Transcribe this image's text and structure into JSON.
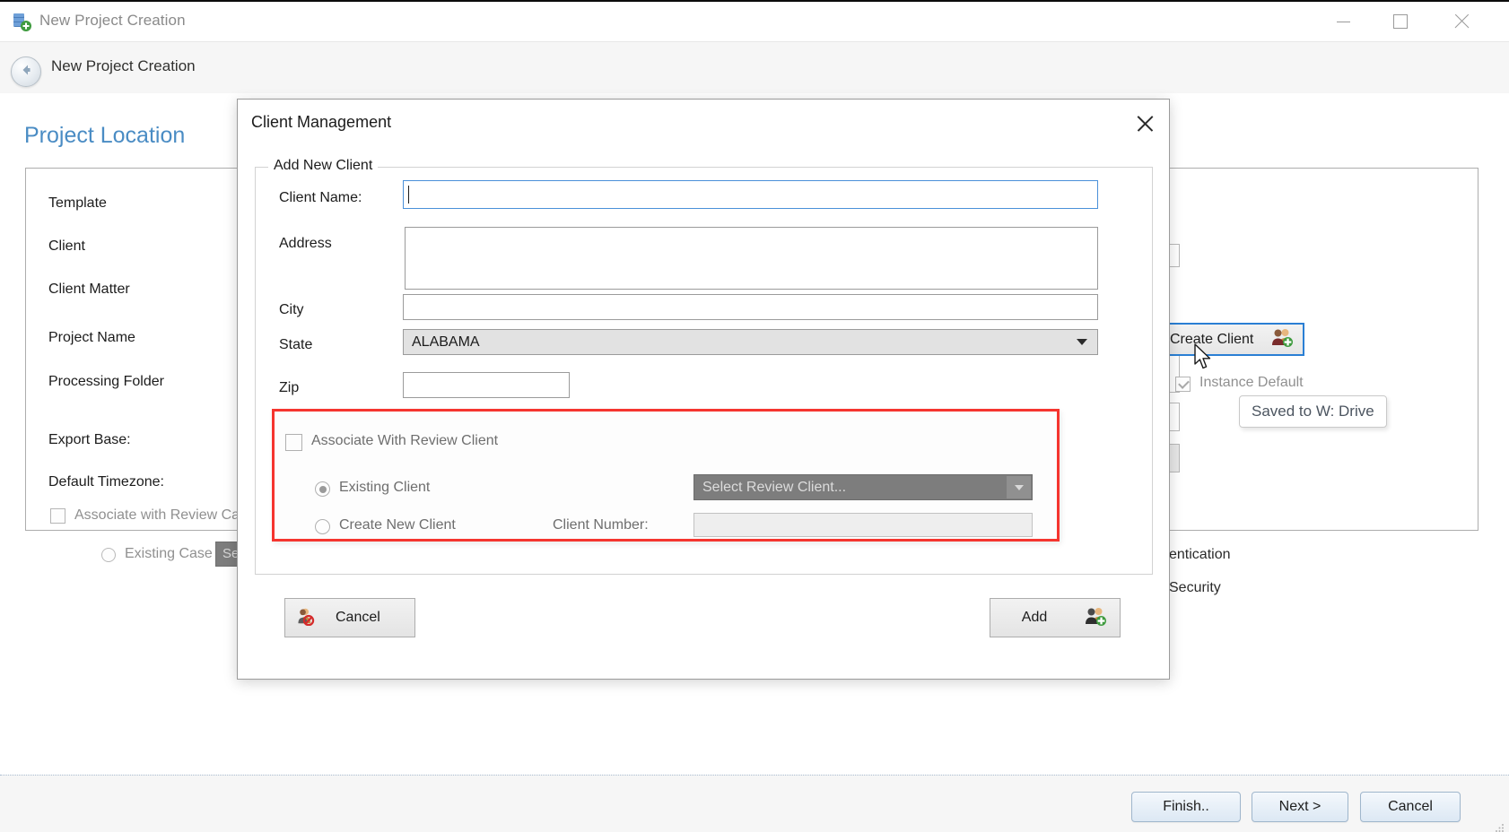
{
  "window": {
    "title": "New Project Creation",
    "icon": "app-database-add-icon",
    "minimize": "minimize",
    "maximize": "maximize",
    "close": "close"
  },
  "wizard": {
    "back_icon": "back-arrow-icon",
    "header_title": "New Project Creation",
    "page_title": "Project Location",
    "fields": [
      {
        "label": "Template"
      },
      {
        "label": "Client"
      },
      {
        "label": "Client Matter"
      },
      {
        "label": "Project Name"
      },
      {
        "label": "Processing Folder"
      },
      {
        "label": "Export Base:"
      },
      {
        "label": "Default Timezone:"
      }
    ],
    "associate_review_case": {
      "label": "Associate with Review Case",
      "checked": false
    },
    "existing_case": {
      "label": "Existing Case",
      "selected": false,
      "select_placeholder": "Se"
    },
    "create_client_button": {
      "label": "Create Client",
      "icon": "users-add-icon"
    },
    "tooltip": "Saved to W: Drive",
    "instance_default": {
      "label": "Instance Default",
      "checked": true
    },
    "right_items": [
      {
        "label": "entication"
      },
      {
        "label": "Security"
      }
    ]
  },
  "footer": {
    "finish": "Finish..",
    "next": "Next >",
    "cancel": "Cancel"
  },
  "dialog": {
    "title": "Client Management",
    "close_icon": "close-icon",
    "legend": "Add New Client",
    "fields": {
      "client_name": {
        "label": "Client Name:",
        "value": "",
        "focused": true
      },
      "address": {
        "label": "Address",
        "value": ""
      },
      "city": {
        "label": "City",
        "value": ""
      },
      "state": {
        "label": "State",
        "value": "ALABAMA"
      },
      "zip": {
        "label": "Zip",
        "value": ""
      }
    },
    "review_section": {
      "associate_checkbox": {
        "label": "Associate With Review Client",
        "checked": false
      },
      "existing_client": {
        "label": "Existing Client",
        "selected": true,
        "select_placeholder": "Select Review Client..."
      },
      "create_new_client": {
        "label": "Create New Client",
        "selected": false,
        "client_number_label": "Client Number:",
        "client_number_value": ""
      }
    },
    "buttons": {
      "cancel": {
        "label": "Cancel",
        "icon": "users-cancel-icon"
      },
      "add": {
        "label": "Add",
        "icon": "users-add-icon"
      }
    }
  },
  "colors": {
    "accent_blue": "#4a8cc4",
    "focus_blue": "#4a90d9",
    "highlight_red": "#f5352f",
    "button_border_blue": "#2a7fd4"
  }
}
